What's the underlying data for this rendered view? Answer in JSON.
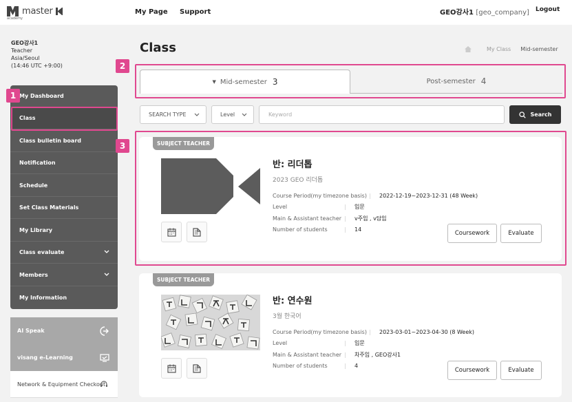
{
  "header": {
    "brand": "master",
    "brand_sub": "academy",
    "nav": [
      "My Page",
      "Support"
    ],
    "user_name": "GEO강사1",
    "user_id": "[geo_company]",
    "logout": "Logout"
  },
  "profile": {
    "name": "GEO강사1",
    "role": "Teacher",
    "timezone": "Asia/Seoul",
    "time": "(14:46 UTC +9:00)"
  },
  "sidebar": {
    "items": [
      {
        "label": "My Dashboard"
      },
      {
        "label": "Class"
      },
      {
        "label": "Class bulletin board"
      },
      {
        "label": "Notification"
      },
      {
        "label": "Schedule"
      },
      {
        "label": "Set Class Materials"
      },
      {
        "label": "My Library"
      },
      {
        "label": "Class evaluate"
      },
      {
        "label": "Members"
      },
      {
        "label": "My Information"
      }
    ],
    "extra": [
      {
        "label": "AI Speak"
      },
      {
        "label": "visang e-Learning"
      },
      {
        "label": "Network & Equipment Checkout"
      }
    ]
  },
  "page": {
    "title": "Class",
    "breadcrumb": [
      "My Class",
      "Mid-semester"
    ]
  },
  "tabs": [
    {
      "label": "Mid-semester",
      "count": "3"
    },
    {
      "label": "Post-semester",
      "count": "4"
    }
  ],
  "filters": {
    "search_type": "SEARCH TYPE",
    "level": "Level",
    "keyword_placeholder": "Keyword",
    "search_label": "Search"
  },
  "cards": [
    {
      "badge": "SUBJECT TEACHER",
      "title": "반: 리더톱",
      "subtitle": "2023 GEO 리더톱",
      "labels": [
        "Course Period(my timezone basis)",
        "Level",
        "Main & Assistant teacher",
        "Number of students"
      ],
      "values": [
        "2022-12-19~2023-12-31 (48 Week)",
        "입문",
        "v주임 , v담임",
        "14"
      ],
      "coursework": "Coursework",
      "evaluate": "Evaluate"
    },
    {
      "badge": "SUBJECT TEACHER",
      "title": "반: 연수원",
      "subtitle": "3월 한국어",
      "labels": [
        "Course Period(my timezone basis)",
        "Level",
        "Main & Assistant teacher",
        "Number of students"
      ],
      "values": [
        "2023-03-01~2023-04-30 (8 Week)",
        "입문",
        "차주임 , GEO강사1",
        "4"
      ],
      "coursework": "Coursework",
      "evaluate": "Evaluate"
    }
  ],
  "annotations": [
    "1",
    "2",
    "3"
  ],
  "colors": {
    "highlight": "#e0488f",
    "sidebar": "#5a5a5a",
    "search_button": "#333333"
  }
}
